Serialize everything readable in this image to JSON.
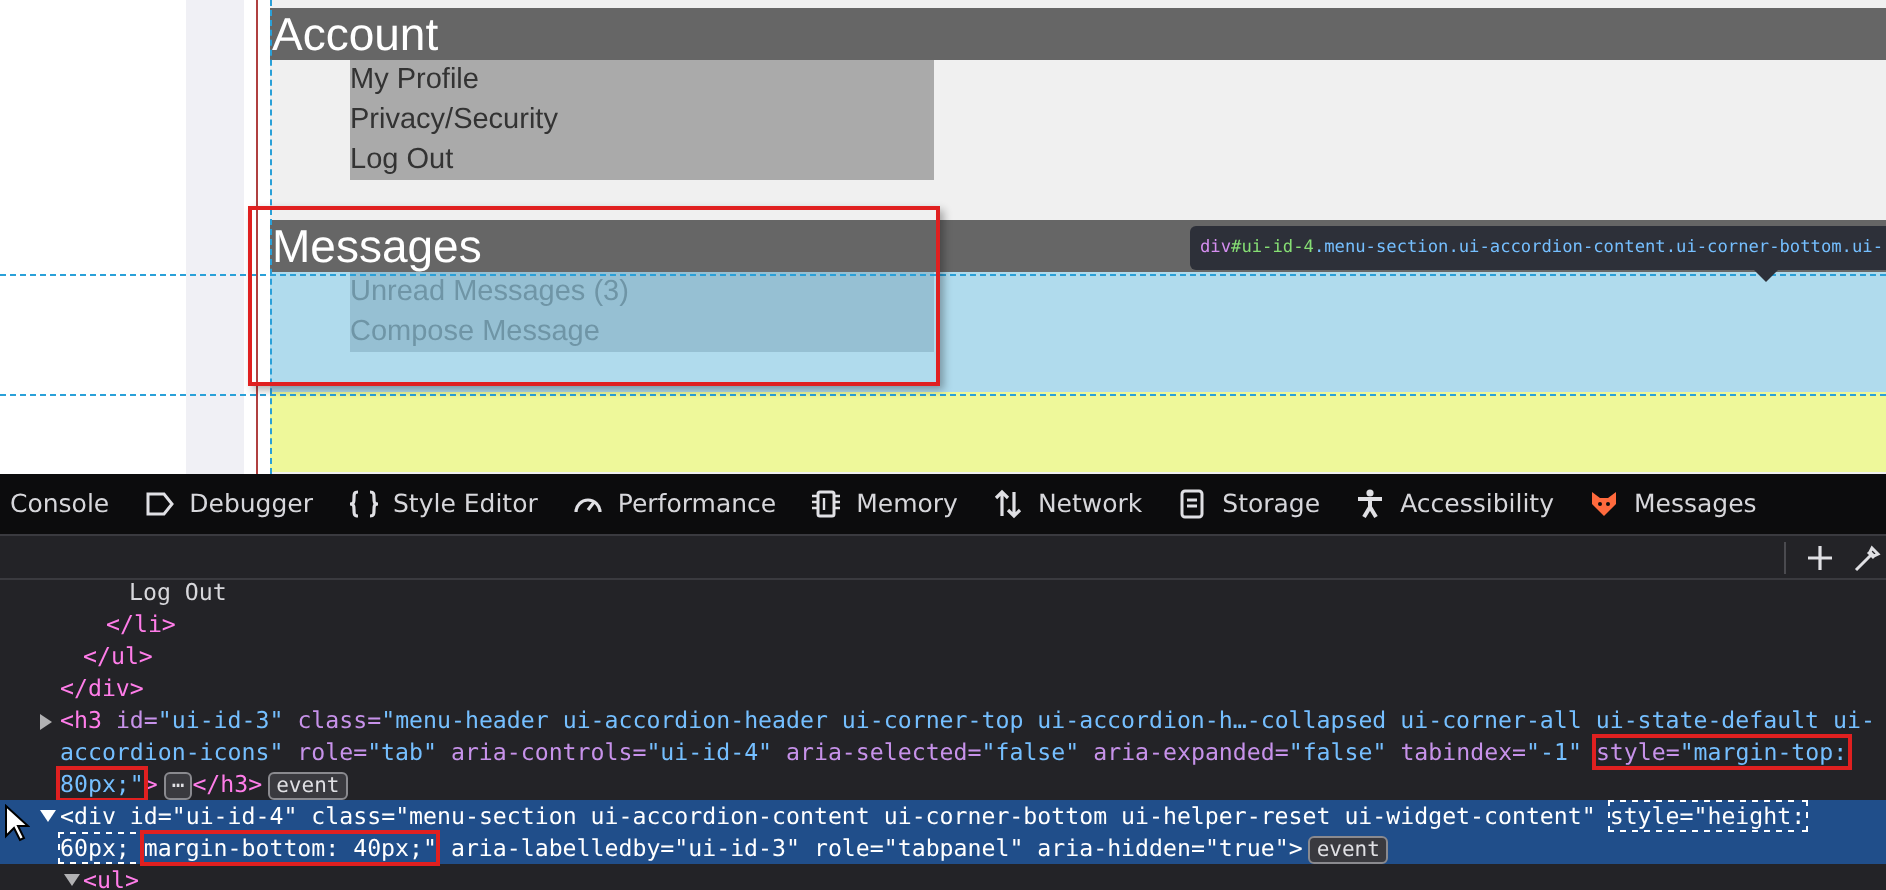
{
  "page": {
    "sections": [
      {
        "title": "Account",
        "highlighted": false,
        "items": [
          "My Profile",
          "Privacy/Security",
          "Log Out"
        ]
      },
      {
        "title": "Messages",
        "highlighted": true,
        "items": [
          "Unread Messages (3)",
          "Compose Message"
        ]
      }
    ],
    "tooltip": {
      "tag": "div",
      "id": "#ui-id-4",
      "classes": ".menu-section.ui-accordion-content.ui-corner-bottom.ui-"
    }
  },
  "devtools": {
    "tabs": [
      {
        "label": "Console",
        "kind": "console"
      },
      {
        "label": "Debugger",
        "kind": "debugger"
      },
      {
        "label": "Style Editor",
        "kind": "style"
      },
      {
        "label": "Performance",
        "kind": "performance"
      },
      {
        "label": "Memory",
        "kind": "memory"
      },
      {
        "label": "Network",
        "kind": "network"
      },
      {
        "label": "Storage",
        "kind": "storage"
      },
      {
        "label": "Accessibility",
        "kind": "accessibility"
      },
      {
        "label": "Messages",
        "kind": "extension"
      }
    ],
    "markup": [
      {
        "children": [
          {
            "children": [
              {
                "children": [
                  {
                    "selected": false,
                    "tokens": [
                      {
                        "kind": "text",
                        "text": "Log Out"
                      }
                    ]
                  }
                ]
              },
              {
                "selected": false,
                "tokens": [
                  {
                    "kind": "tag",
                    "text": "</li>"
                  }
                ]
              }
            ]
          },
          {
            "selected": false,
            "tokens": [
              {
                "kind": "tag",
                "text": "</ul>"
              }
            ]
          }
        ]
      },
      {
        "selected": false,
        "tokens": [
          {
            "kind": "tag",
            "text": "</div>"
          }
        ]
      },
      {
        "selected": false,
        "expanded": false,
        "tokens": [
          {
            "kind": "tag",
            "text": "<h3"
          },
          {
            "kind": "attr",
            "name": "id=",
            "value": [
              {
                "text": "\"ui-id-3\""
              }
            ]
          },
          {
            "kind": "attr",
            "name": "class=",
            "value": [
              {
                "text": "\"menu-header ui-accordion-header ui-corner-top ui-accordion-h…-collapsed ui-corner-all ui-state-default ui-accordion-icons\""
              }
            ]
          },
          {
            "kind": "attr",
            "name": "role=",
            "value": [
              {
                "text": "\"tab\""
              }
            ]
          },
          {
            "kind": "attr",
            "name": "aria-controls=",
            "value": [
              {
                "text": "\"ui-id-4\""
              }
            ]
          },
          {
            "kind": "attr",
            "name": "aria-selected=",
            "value": [
              {
                "text": "\"false\""
              }
            ]
          },
          {
            "kind": "attr",
            "name": "aria-expanded=",
            "value": [
              {
                "text": "\"false\""
              }
            ]
          },
          {
            "kind": "attr",
            "name": "tabindex=",
            "value": [
              {
                "text": "\"-1\""
              }
            ]
          },
          {
            "kind": "attr",
            "name": "style=",
            "boxed": true,
            "value": [
              {
                "text": "\"margin-top: 80px;\""
              }
            ]
          },
          {
            "kind": "tag",
            "text": ">"
          },
          {
            "kind": "badge",
            "text": "⋯"
          },
          {
            "kind": "tag",
            "text": "</h3>"
          },
          {
            "kind": "badge",
            "text": "event"
          }
        ]
      },
      {
        "selected": true,
        "expanded": true,
        "tokens": [
          {
            "kind": "tag",
            "text": "<div"
          },
          {
            "kind": "attr",
            "name": "id=",
            "value": [
              {
                "text": "\"ui-id-4\""
              }
            ]
          },
          {
            "kind": "attr",
            "name": "class=",
            "value": [
              {
                "text": "\"menu-section ui-accordion-content ui-corner-bottom ui-helper-reset ui-widget-content\""
              }
            ]
          },
          {
            "kind": "attr",
            "name": "style=",
            "hovered": true,
            "value": [
              {
                "text": "\"height: 60px; "
              },
              {
                "text": "margin-bottom: 40px;\"",
                "boxed": true
              }
            ]
          },
          {
            "kind": "attr",
            "name": "aria-labelledby=",
            "value": [
              {
                "text": "\"ui-id-3\""
              }
            ]
          },
          {
            "kind": "attr",
            "name": "role=",
            "value": [
              {
                "text": "\"tabpanel\""
              }
            ]
          },
          {
            "kind": "attr",
            "name": "aria-hidden=",
            "value": [
              {
                "text": "\"true\""
              }
            ]
          },
          {
            "kind": "tag",
            "text": ">"
          },
          {
            "kind": "badge",
            "text": "event"
          }
        ],
        "children": [
          {
            "selected": false,
            "expanded": true,
            "tokens": [
              {
                "kind": "tag",
                "text": "<ul>"
              }
            ]
          }
        ]
      }
    ]
  }
}
